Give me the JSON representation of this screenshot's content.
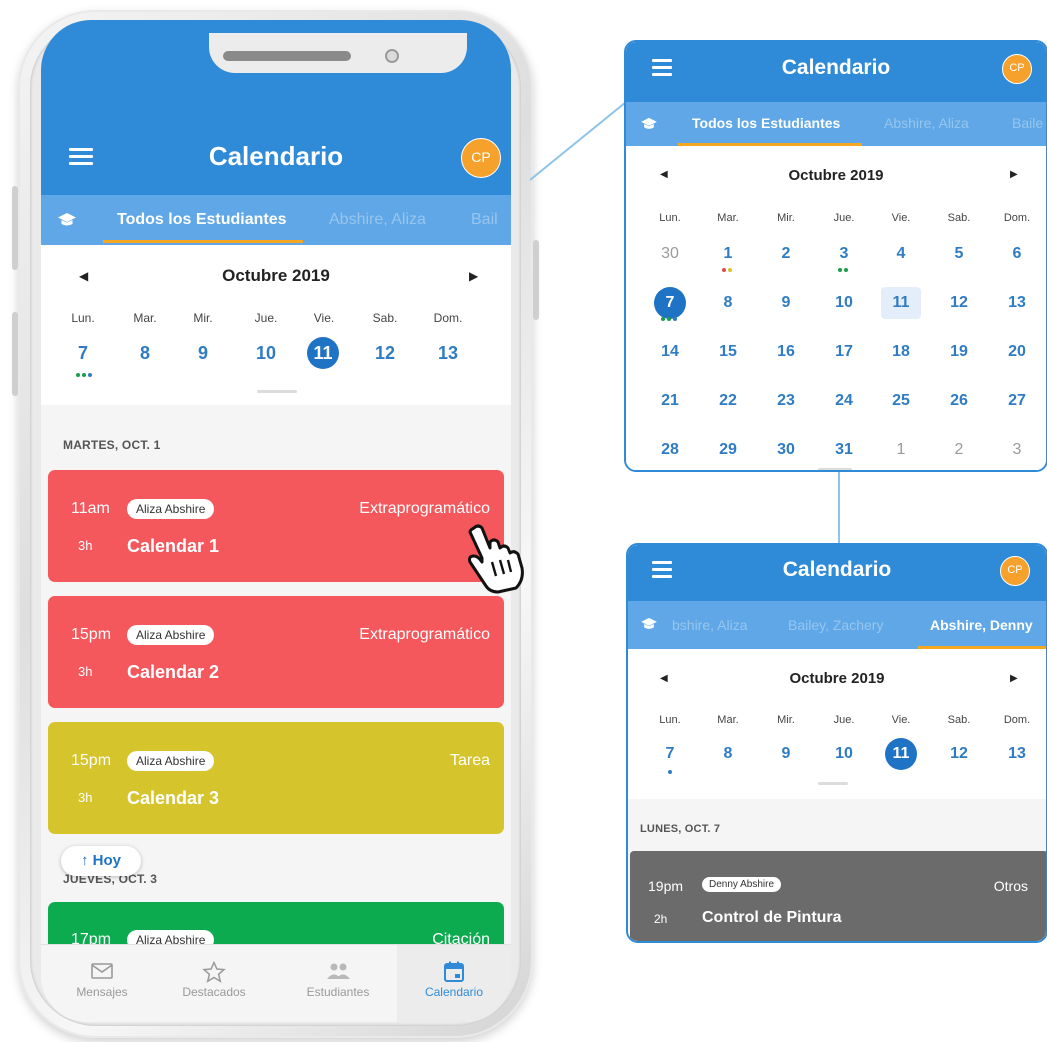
{
  "colors": {
    "primary": "#2f8bd8",
    "tab_bar": "#5fa7e6",
    "accent_orange": "#f5a623",
    "event_red": "#f4575c",
    "event_yellow": "#d6c42c",
    "event_green": "#0cab4f",
    "event_gray": "#6b6b6b"
  },
  "app": {
    "title": "Calendario",
    "avatar": "CP"
  },
  "phone": {
    "tabs": [
      "Todos los Estudiantes",
      "Abshire, Aliza",
      "Bail"
    ],
    "month": "Octubre 2019",
    "weekdays": [
      "Lun.",
      "Mar.",
      "Mir.",
      "Jue.",
      "Vie.",
      "Sab.",
      "Dom."
    ],
    "week_days": [
      "7",
      "8",
      "9",
      "10",
      "11",
      "12",
      "13"
    ],
    "section1": "MARTES, OCT. 1",
    "events": [
      {
        "time": "11am",
        "student": "Aliza Abshire",
        "category": "Extraprogramático",
        "duration": "3h",
        "name": "Calendar 1"
      },
      {
        "time": "15pm",
        "student": "Aliza Abshire",
        "category": "Extraprogramático",
        "duration": "3h",
        "name": "Calendar 2"
      },
      {
        "time": "15pm",
        "student": "Aliza Abshire",
        "category": "Tarea",
        "duration": "3h",
        "name": "Calendar 3"
      },
      {
        "time": "17pm",
        "student": "Aliza Abshire",
        "category": "Citación",
        "duration": "",
        "name": ""
      }
    ],
    "today_button": "↑ Hoy",
    "section2": "JUEVES, OCT. 3",
    "nav": [
      {
        "label": "Mensajes",
        "icon": "mail-icon"
      },
      {
        "label": "Destacados",
        "icon": "star-icon"
      },
      {
        "label": "Estudiantes",
        "icon": "people-icon"
      },
      {
        "label": "Calendario",
        "icon": "calendar-icon"
      }
    ]
  },
  "month_panel": {
    "tabs": [
      "Todos los Estudiantes",
      "Abshire, Aliza",
      "Baile"
    ],
    "month": "Octubre 2019",
    "weekdays": [
      "Lun.",
      "Mar.",
      "Mir.",
      "Jue.",
      "Vie.",
      "Sab.",
      "Dom."
    ],
    "weeks": [
      [
        "30",
        "1",
        "2",
        "3",
        "4",
        "5",
        "6"
      ],
      [
        "7",
        "8",
        "9",
        "10",
        "11",
        "12",
        "13"
      ],
      [
        "14",
        "15",
        "16",
        "17",
        "18",
        "19",
        "20"
      ],
      [
        "21",
        "22",
        "23",
        "24",
        "25",
        "26",
        "27"
      ],
      [
        "28",
        "29",
        "30",
        "31",
        "1",
        "2",
        "3"
      ]
    ]
  },
  "student_panel": {
    "tabs": [
      "bshire, Aliza",
      "Bailey, Zachery",
      "Abshire, Denny"
    ],
    "month": "Octubre 2019",
    "weekdays": [
      "Lun.",
      "Mar.",
      "Mir.",
      "Jue.",
      "Vie.",
      "Sab.",
      "Dom."
    ],
    "week_days": [
      "7",
      "8",
      "9",
      "10",
      "11",
      "12",
      "13"
    ],
    "section": "LUNES, OCT. 7",
    "event": {
      "time": "19pm",
      "student": "Denny Abshire",
      "category": "Otros",
      "duration": "2h",
      "name": "Control de Pintura"
    }
  }
}
